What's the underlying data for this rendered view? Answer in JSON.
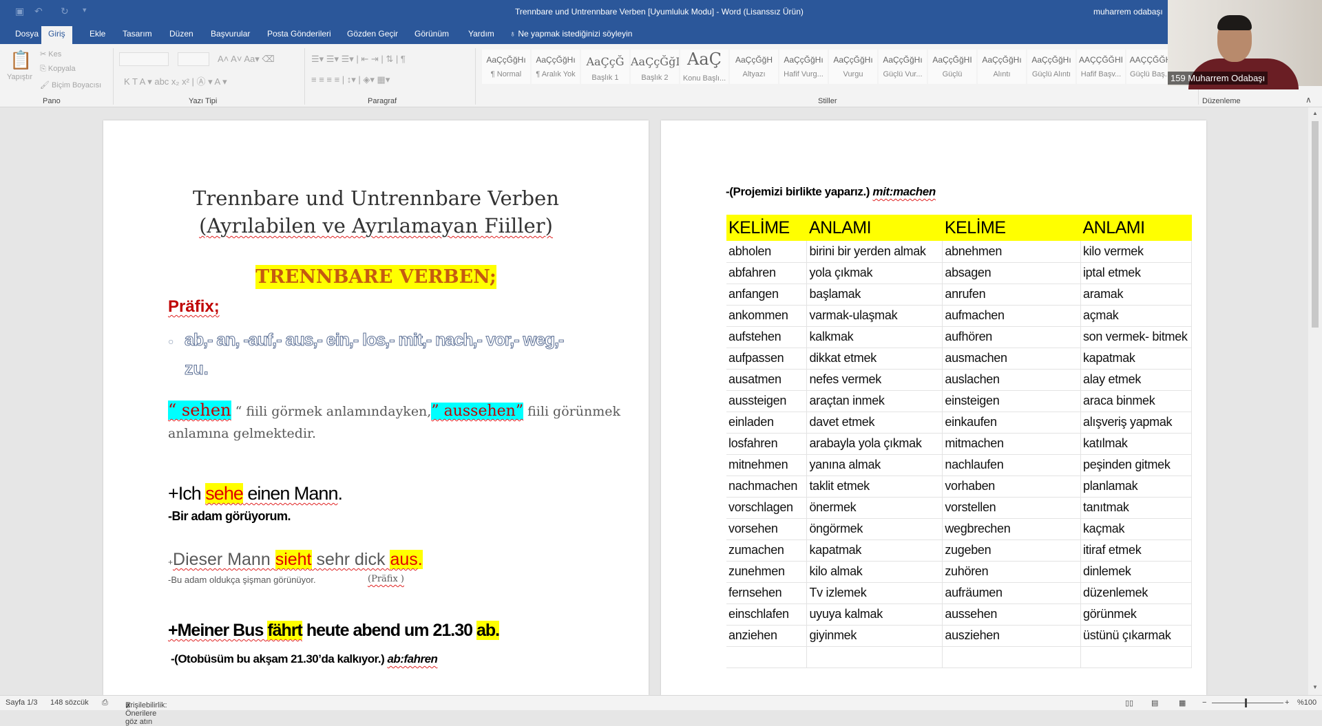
{
  "window": {
    "title": "Trennbare und Untrennbare Verben [Uyumluluk Modu]  -  Word (Lisanssız Ürün)",
    "user": "muharrem odabaşı"
  },
  "menu_tabs": [
    "Dosya",
    "Giriş",
    "Ekle",
    "Tasarım",
    "Düzen",
    "Başvurular",
    "Posta Gönderileri",
    "Gözden Geçir",
    "Görünüm",
    "Yardım"
  ],
  "active_tab": "Giriş",
  "tell_me": "Ne yapmak istediğinizi söyleyin",
  "ribbon": {
    "groups": [
      "Pano",
      "Yazı Tipi",
      "Paragraf",
      "Stiller",
      "Düzenleme"
    ],
    "clipboard": {
      "paste": "Yapıştır",
      "cut": "Kes",
      "copy": "Kopyala",
      "format_painter": "Biçim Boyacısı"
    },
    "styles": [
      {
        "preview": "AaÇçĞğHı",
        "name": "¶ Normal"
      },
      {
        "preview": "AaÇçĞğHı",
        "name": "¶ Aralık Yok"
      },
      {
        "preview": "AaÇçĞ",
        "name": "Başlık 1"
      },
      {
        "preview": "AaÇçĞğI",
        "name": "Başlık 2"
      },
      {
        "preview": "AaÇ",
        "name": "Konu Başlı..."
      },
      {
        "preview": "AaÇçĞğH",
        "name": "Altyazı"
      },
      {
        "preview": "AaÇçĞğHı",
        "name": "Hafif Vurg..."
      },
      {
        "preview": "AaÇçĞğHı",
        "name": "Vurgu"
      },
      {
        "preview": "AaÇçĞğHı",
        "name": "Güçlü Vur..."
      },
      {
        "preview": "AaÇçĞğHI",
        "name": "Güçlü"
      },
      {
        "preview": "AaÇçĞğHı",
        "name": "Alıntı"
      },
      {
        "preview": "AaÇçĞğHı",
        "name": "Güçlü Alıntı"
      },
      {
        "preview": "AAÇÇĞĞHI",
        "name": "Hafif Başv..."
      },
      {
        "preview": "AAÇÇĞĞH",
        "name": "Güçlü Baş..."
      }
    ]
  },
  "webcam": {
    "label": "159 Muharrem Odabaşı"
  },
  "left_page": {
    "title1": "Trennbare und Untrennbare Verben",
    "title2": "(Ayrılabilen ve Ayrılamayan Fiiller)",
    "heading": "TRENNBARE VERBEN;",
    "prefix_label": "Präfix;",
    "prefixes_line1": "ab,- an, -auf,- aus,- ein,- los,- mit,- nach,- vor,- weg,-",
    "prefixes_line2": "zu.",
    "sehen": "“ sehen",
    "sehen_mid": " “ fiili görmek anlamındayken,",
    "aussehen": "” aussehen”",
    "sehen_end": " fiili görünmek",
    "sehen_line2": "anlamına gelmektedir.",
    "ex1_a": "+Ich ",
    "ex1_b": "sehe",
    "ex1_c": " einen Mann",
    ".": "",
    "ex1_dot": ".",
    "ex1_tr": "-Bir adam görüyorum.",
    "ex2_a": "+",
    "ex2_b": "Dieser Mann ",
    "ex2_c": "sieht",
    "ex2_d": " sehr dick ",
    "ex2_e": "aus",
    "ex2_dot": ".",
    "ex2_tr": "-Bu adam oldukça şişman görünüyor.",
    "ex2_note": "(Präfix )",
    "ex3_a": "+Meiner Bus ",
    "ex3_b": "fährt",
    "ex3_c": " heute abend um 21.30 ",
    "ex3_d": "ab.",
    "ex3_tr": "-(Otobüsüm bu akşam 21.30’da kalkıyor.) ",
    "ex3_tr_it": "ab:fahren"
  },
  "right_page": {
    "line": "-(Projemizi birlikte yaparız.) ",
    "line_it": "mit:machen",
    "headers": [
      "KELİME",
      "ANLAMI",
      "KELİME",
      "ANLAMI"
    ],
    "rows": [
      [
        "abholen",
        "birini bir yerden almak",
        "abnehmen",
        "kilo vermek"
      ],
      [
        "abfahren",
        "yola çıkmak",
        "absagen",
        "iptal etmek"
      ],
      [
        "anfangen",
        "başlamak",
        "anrufen",
        "aramak"
      ],
      [
        "ankommen",
        "varmak-ulaşmak",
        "aufmachen",
        "açmak"
      ],
      [
        "aufstehen",
        "kalkmak",
        "aufhören",
        "son vermek- bitmek"
      ],
      [
        "aufpassen",
        "dikkat etmek",
        "ausmachen",
        "kapatmak"
      ],
      [
        "ausatmen",
        "nefes vermek",
        "auslachen",
        "alay etmek"
      ],
      [
        "aussteigen",
        "araçtan inmek",
        "einsteigen",
        "araca binmek"
      ],
      [
        "einladen",
        "davet etmek",
        "einkaufen",
        "alışveriş yapmak"
      ],
      [
        "losfahren",
        "arabayla yola çıkmak",
        "mitmachen",
        "katılmak"
      ],
      [
        "mitnehmen",
        "yanına almak",
        "nachlaufen",
        "peşinden gitmek"
      ],
      [
        "nachmachen",
        "taklit etmek",
        "vorhaben",
        "planlamak"
      ],
      [
        "vorschlagen",
        "önermek",
        "vorstellen",
        "tanıtmak"
      ],
      [
        "vorsehen",
        "öngörmek",
        "wegbrechen",
        "kaçmak"
      ],
      [
        "zumachen",
        "kapatmak",
        "zugeben",
        "itiraf etmek"
      ],
      [
        "zunehmen",
        "kilo almak",
        "zuhören",
        "dinlemek"
      ],
      [
        "fernsehen",
        "Tv izlemek",
        "aufräumen",
        "düzenlemek"
      ],
      [
        "einschlafen",
        "uyuya kalmak",
        "aussehen",
        "görünmek"
      ],
      [
        "anziehen",
        "giyinmek",
        "ausziehen",
        "üstünü çıkarmak"
      ],
      [
        "",
        "",
        "",
        ""
      ]
    ]
  },
  "status": {
    "page": "Sayfa 1/3",
    "words": "148 sözcük",
    "accessibility": "Erişilebilirlik: Önerilere göz atın",
    "zoom": "%100",
    "zoom_percent": 100
  },
  "colors": {
    "titlebar": "#2b579a",
    "highlight_yellow": "#ffff00",
    "highlight_cyan": "#00ffff",
    "heading_orange": "#c55a11",
    "prefix_red": "#c00000"
  }
}
